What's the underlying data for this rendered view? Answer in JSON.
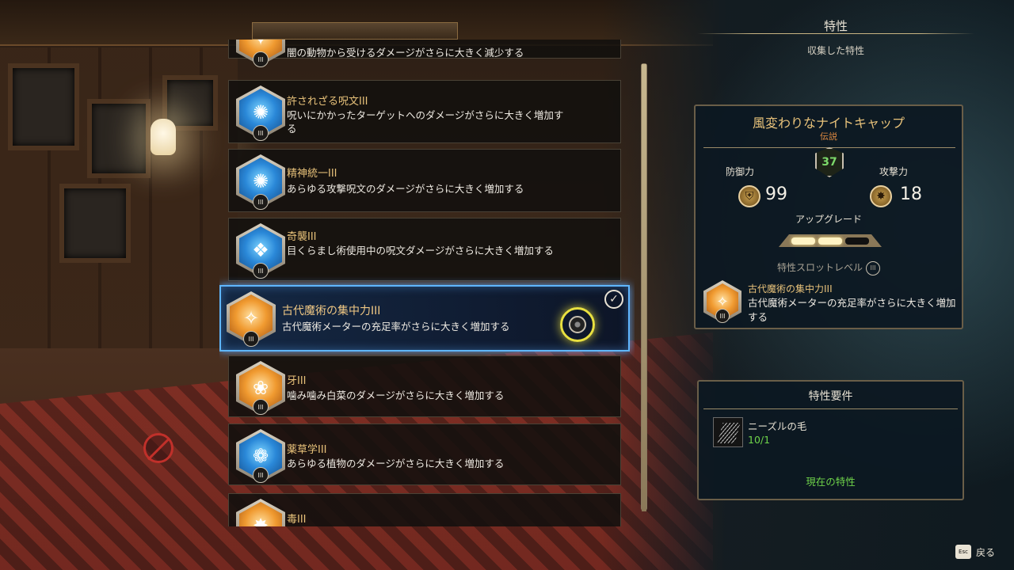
{
  "header": {
    "title": "特性",
    "subtitle": "収集した特性"
  },
  "traits": [
    {
      "name": "",
      "desc": "闇の動物から受けるダメージがさらに大きく減少する",
      "color": "gold",
      "tier": "III",
      "partial": true
    },
    {
      "name": "許されざる呪文III",
      "desc": "呪いにかかったターゲットへのダメージがさらに大きく増加する",
      "color": "blue",
      "tier": "III"
    },
    {
      "name": "精神統一III",
      "desc": "あらゆる攻撃呪文のダメージがさらに大きく増加する",
      "color": "blue",
      "tier": "III"
    },
    {
      "name": "奇襲III",
      "desc": "目くらまし術使用中の呪文ダメージがさらに大きく増加する",
      "color": "blue",
      "tier": "III"
    },
    {
      "name": "古代魔術の集中力III",
      "desc": "古代魔術メーターの充足率がさらに大きく増加する",
      "color": "gold",
      "tier": "III",
      "selected": true
    },
    {
      "name": "牙III",
      "desc": "噛み噛み白菜のダメージがさらに大きく増加する",
      "color": "gold",
      "tier": "III"
    },
    {
      "name": "薬草学III",
      "desc": "あらゆる植物のダメージがさらに大きく増加する",
      "color": "blue",
      "tier": "III"
    },
    {
      "name": "毒III",
      "desc": "",
      "color": "gold",
      "tier": "III"
    }
  ],
  "gear": {
    "name": "風変わりなナイトキャップ",
    "rarity": "伝説",
    "level": "37",
    "defense_label": "防御力",
    "defense_value": "99",
    "attack_label": "攻撃力",
    "attack_value": "18",
    "upgrade_label": "アップグレード",
    "upgrade_filled": 2,
    "upgrade_total": 3,
    "slot_label": "特性スロットレベル",
    "slot_tier": "III",
    "equipped_trait_name": "古代魔術の集中力III",
    "equipped_trait_desc": "古代魔術メーターの充足率がさらに大きく増加する",
    "equipped_trait_tier": "III"
  },
  "requirements": {
    "title": "特性要件",
    "item_name": "ニーズルの毛",
    "item_count": "10/1",
    "status": "現在の特性"
  },
  "footer": {
    "key": "Esc",
    "back_label": "戻る"
  },
  "colors": {
    "accent_gold": "#e8c27a",
    "selection_blue": "#5fb6ff",
    "ok_green": "#6fd44a",
    "rarity_orange": "#e08a40"
  }
}
